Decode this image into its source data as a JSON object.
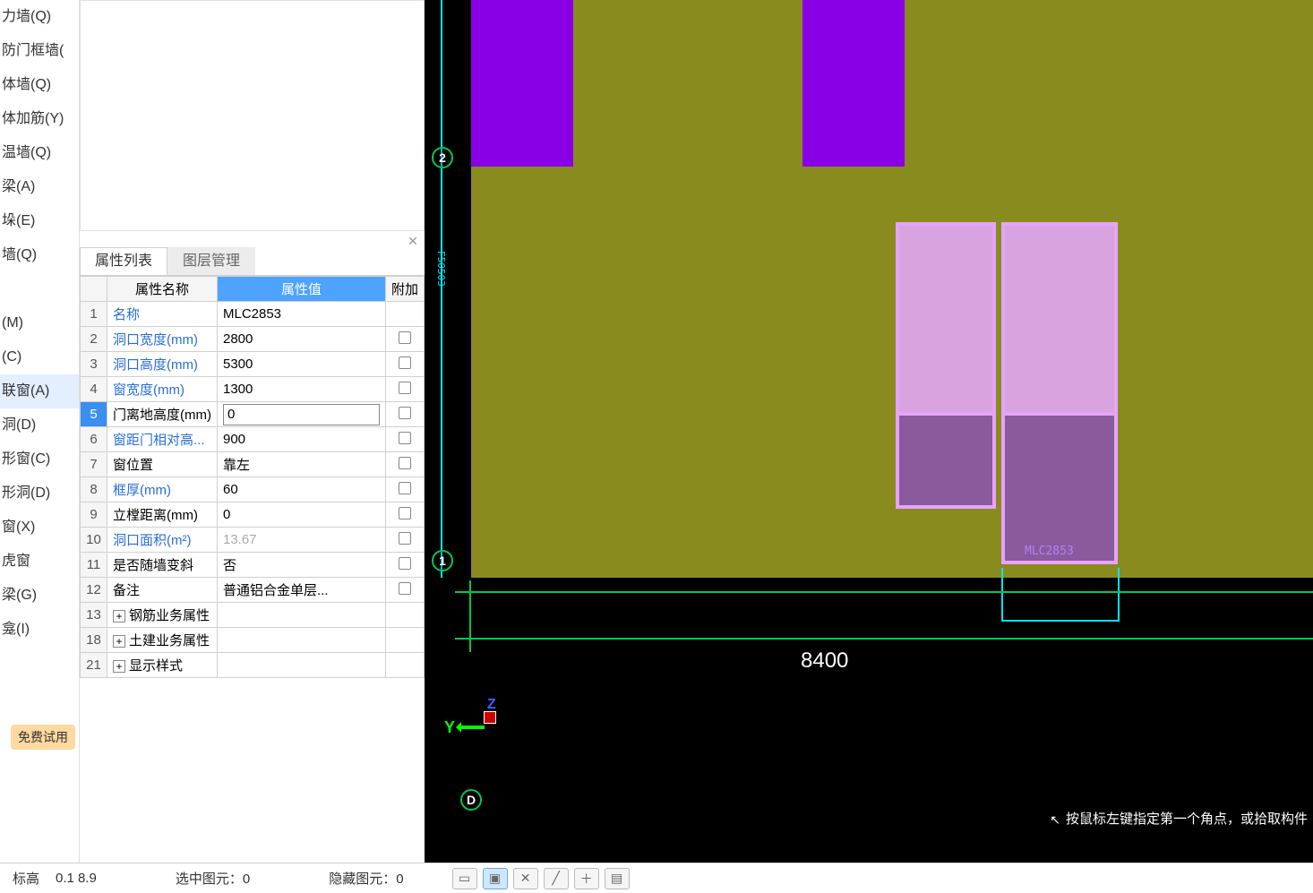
{
  "sidebar": {
    "items": [
      {
        "label": "力墙(Q)"
      },
      {
        "label": "防门框墙("
      },
      {
        "label": "体墙(Q)"
      },
      {
        "label": "体加筋(Y)"
      },
      {
        "label": "温墙(Q)"
      },
      {
        "label": "梁(A)"
      },
      {
        "label": "垛(E)"
      },
      {
        "label": "墙(Q)"
      },
      {
        "label": "(M)"
      },
      {
        "label": "(C)"
      },
      {
        "label": "联窗(A)",
        "selected": true
      },
      {
        "label": "洞(D)"
      },
      {
        "label": "形窗(C)"
      },
      {
        "label": "形洞(D)"
      },
      {
        "label": "窗(X)"
      },
      {
        "label": "虎窗"
      },
      {
        "label": "梁(G)"
      },
      {
        "label": "龛(I)"
      }
    ],
    "trial_label": "免费试用"
  },
  "tabs": {
    "prop": "属性列表",
    "layer": "图层管理"
  },
  "table": {
    "headers": {
      "name": "属性名称",
      "value": "属性值",
      "extra": "附加"
    },
    "rows": [
      {
        "n": "1",
        "name": "名称",
        "value": "MLC2853",
        "link": true,
        "chk": false,
        "expand": false
      },
      {
        "n": "2",
        "name": "洞口宽度(mm)",
        "value": "2800",
        "link": true,
        "chk": true,
        "expand": false
      },
      {
        "n": "3",
        "name": "洞口高度(mm)",
        "value": "5300",
        "link": true,
        "chk": true,
        "expand": false
      },
      {
        "n": "4",
        "name": "窗宽度(mm)",
        "value": "1300",
        "link": true,
        "chk": true,
        "expand": false
      },
      {
        "n": "5",
        "name": "门离地高度(mm)",
        "value": "0",
        "link": false,
        "chk": true,
        "expand": false,
        "editing": true,
        "selected": true
      },
      {
        "n": "6",
        "name": "窗距门相对高...",
        "value": "900",
        "link": true,
        "chk": true,
        "expand": false
      },
      {
        "n": "7",
        "name": "窗位置",
        "value": "靠左",
        "link": false,
        "chk": true,
        "expand": false
      },
      {
        "n": "8",
        "name": "框厚(mm)",
        "value": "60",
        "link": true,
        "chk": true,
        "expand": false
      },
      {
        "n": "9",
        "name": "立樘距离(mm)",
        "value": "0",
        "link": false,
        "chk": true,
        "expand": false
      },
      {
        "n": "10",
        "name": "洞口面积(m²)",
        "value": "13.67",
        "link": true,
        "chk": true,
        "expand": false,
        "muted": true
      },
      {
        "n": "11",
        "name": "是否随墙变斜",
        "value": "否",
        "link": false,
        "chk": true,
        "expand": false
      },
      {
        "n": "12",
        "name": "备注",
        "value": "普通铝合金单层...",
        "link": false,
        "chk": true,
        "expand": false
      },
      {
        "n": "13",
        "name": "钢筋业务属性",
        "value": "",
        "link": false,
        "chk": false,
        "expand": true
      },
      {
        "n": "18",
        "name": "土建业务属性",
        "value": "",
        "link": false,
        "chk": false,
        "expand": true
      },
      {
        "n": "21",
        "name": "显示样式",
        "value": "",
        "link": false,
        "chk": false,
        "expand": true
      }
    ]
  },
  "canvas": {
    "axis_top": "2",
    "axis_bottom": "1",
    "axis_letter": "D",
    "dim_main": "8400",
    "element_label": "MLC2853",
    "vert_label": "F50503",
    "y_label": "Y",
    "z_label": "Z"
  },
  "status": {
    "hint": "按鼠标左键指定第一个角点，或拾取构件"
  },
  "bottombar": {
    "seg1a": "标高",
    "seg1b": "0.1  8.9",
    "seg2": "选中图元：0",
    "seg3": "隐藏图元：0"
  }
}
